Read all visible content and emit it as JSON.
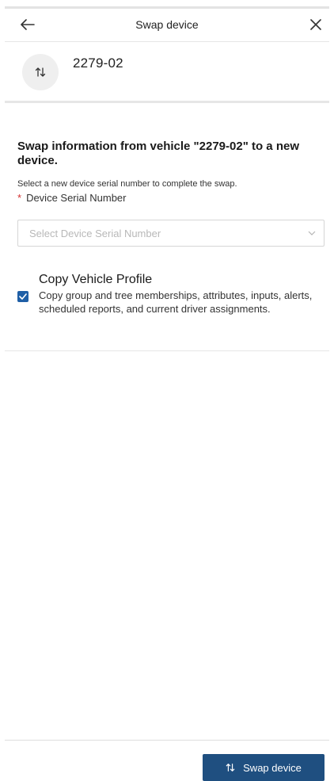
{
  "header": {
    "title": "Swap device",
    "back_icon": "arrow-left-icon",
    "close_icon": "close-icon"
  },
  "vehicle": {
    "name": "2279-02",
    "icon": "swap-arrows-icon"
  },
  "form": {
    "heading": "Swap information from vehicle \"2279-02\" to a new device.",
    "helper_text": "Select a new device serial number to complete the swap.",
    "required_marker": "*",
    "field_label": "Device Serial Number",
    "select_placeholder": "Select Device Serial Number",
    "select_icon": "chevron-down-icon"
  },
  "copy_profile": {
    "title": "Copy Vehicle Profile",
    "checked": true,
    "description": "Copy group and tree memberships, attributes, inputs, alerts, scheduled reports, and current driver assignments."
  },
  "footer": {
    "swap_button_label": "Swap device"
  },
  "colors": {
    "primary": "#1f4f80",
    "checkbox": "#1f5fa6",
    "required": "#d32f2f"
  }
}
